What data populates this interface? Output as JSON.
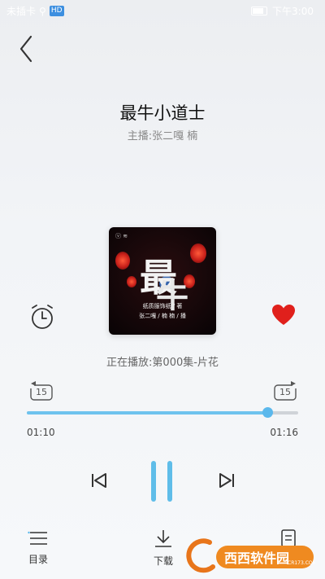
{
  "status_bar": {
    "carrier": "未插卡",
    "hd": "HD",
    "time": "下午3:00"
  },
  "header": {
    "back_icon": "chevron-left-icon",
    "title": "最牛小道士",
    "host": "主播:张二嘎 楠"
  },
  "cover": {
    "logo_mark": "ⓥ ≋",
    "line1": "纸质服饰纸 / 著",
    "line2": "张二嘎 / 楠 楠 / 播"
  },
  "player": {
    "now_playing": "正在播放:第000集-片花",
    "skip_back_seconds": "15",
    "skip_forward_seconds": "15",
    "elapsed": "01:10",
    "duration": "01:16",
    "progress_fraction": 0.89,
    "is_favorite": true,
    "accent_color": "#5bb8ec",
    "favorite_color": "#e0201c"
  },
  "bottom_bar": {
    "catalog_label": "目录",
    "download_label": "下载",
    "text_label": ""
  },
  "watermark": {
    "brand": "西西软件园",
    "url": "CR173.COM"
  }
}
